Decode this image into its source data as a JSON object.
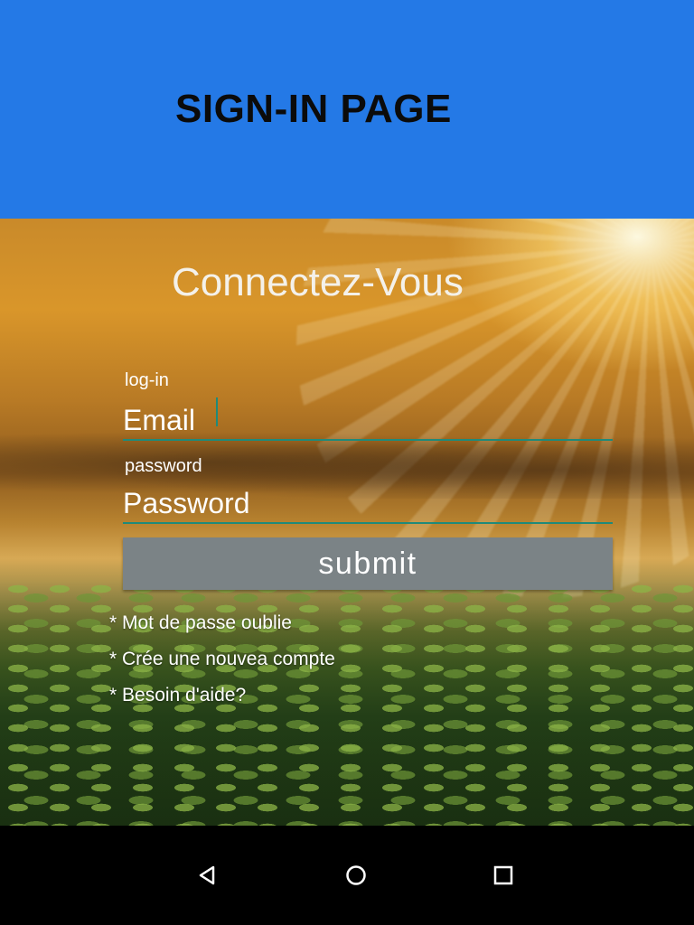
{
  "header": {
    "title": "SIGN-IN PAGE",
    "background_color": "#2479e6"
  },
  "form": {
    "heading": "Connectez-Vous",
    "email": {
      "label": "log-in",
      "placeholder": "Email"
    },
    "password": {
      "label": "password",
      "placeholder": "Password"
    },
    "submit_label": "submit",
    "submit_color": "#7b8386",
    "accent_color": "#1f8a7a"
  },
  "links": [
    "* Mot de passe oublie",
    "* Crée une nouvea compte",
    "* Besoin d'aide?"
  ],
  "navigation": {
    "back_icon": "triangle-back-icon",
    "home_icon": "circle-home-icon",
    "recents_icon": "square-recents-icon"
  }
}
